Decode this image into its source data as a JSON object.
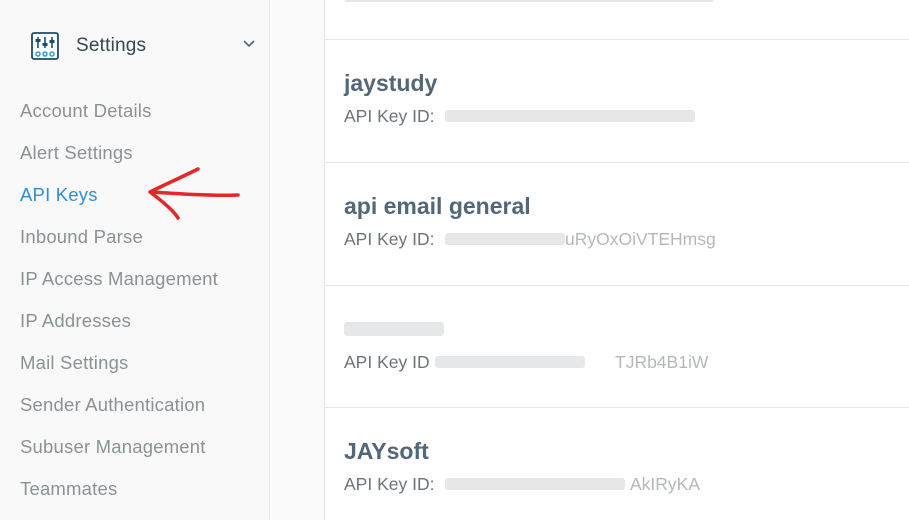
{
  "sidebar": {
    "section_title": "Settings",
    "section_icon": "settings-sliders-icon",
    "items": [
      {
        "label": "Account Details",
        "active": false
      },
      {
        "label": "Alert Settings",
        "active": false
      },
      {
        "label": "API Keys",
        "active": true
      },
      {
        "label": "Inbound Parse",
        "active": false
      },
      {
        "label": "IP Access Management",
        "active": false
      },
      {
        "label": "IP Addresses",
        "active": false
      },
      {
        "label": "Mail Settings",
        "active": false
      },
      {
        "label": "Sender Authentication",
        "active": false
      },
      {
        "label": "Subuser Management",
        "active": false
      },
      {
        "label": "Teammates",
        "active": false
      }
    ]
  },
  "annotation": {
    "icon": "red-arrow-icon",
    "color": "#e8262a"
  },
  "api_keys": {
    "id_label": "API Key ID:",
    "id_label_alt": "API Key ID",
    "cards": [
      {
        "name": "",
        "id_visible": ""
      },
      {
        "name": "jaystudy",
        "id_visible": ""
      },
      {
        "name": "api email general",
        "id_visible": "uRyOxOiVTEHmsg"
      },
      {
        "name": "",
        "id_visible": "TJRb4B1iW"
      },
      {
        "name": "JAYsoft",
        "id_visible": "AkIRyKA"
      }
    ]
  },
  "colors": {
    "active_link": "#2f8fd3",
    "nav_text": "#8a9296",
    "key_name": "#546778"
  }
}
